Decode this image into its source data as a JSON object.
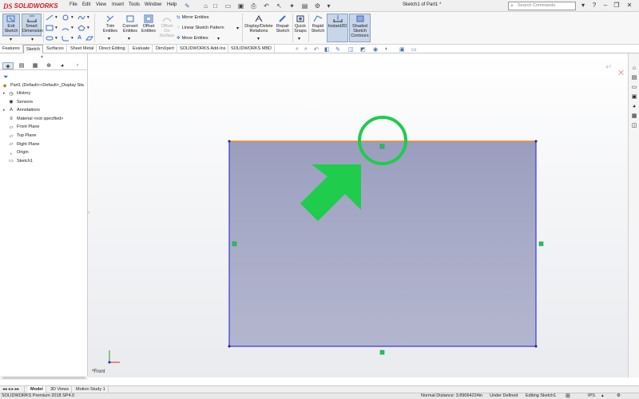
{
  "titlebar": {
    "app_logo": "SOLIDWORKS",
    "menus": [
      "File",
      "Edit",
      "View",
      "Insert",
      "Tools",
      "Window",
      "Help"
    ],
    "document_title": "Sketch1 of Part1 *",
    "search_placeholder": "Search Commands"
  },
  "ribbon": {
    "exit_sketch": [
      "Exit",
      "Sketch"
    ],
    "smart_dimension": [
      "Smart",
      "Dimension"
    ],
    "trim_entities": [
      "Trim",
      "Entities"
    ],
    "convert_entities": [
      "Convert",
      "Entities"
    ],
    "offset_entities": [
      "Offset",
      "Entities"
    ],
    "offset_on_surface": [
      "Offset",
      "On",
      "Surface"
    ],
    "mirror_entities": "Mirror Entities",
    "linear_sketch_pattern": "Linear Sketch Pattern",
    "move_entities": "Move Entities",
    "display_delete_relations": [
      "Display/Delete",
      "Relations"
    ],
    "repair_sketch": [
      "Repair",
      "Sketch"
    ],
    "quick_snaps": [
      "Quick",
      "Snaps"
    ],
    "rapid_sketch": [
      "Rapid",
      "Sketch"
    ],
    "instant2d": "Instant2D",
    "shaded_sketch_contours": [
      "Shaded",
      "Sketch",
      "Contours"
    ]
  },
  "command_tabs": [
    "Features",
    "Sketch",
    "Surfaces",
    "Sheet Metal",
    "Direct Editing",
    "Evaluate",
    "DimXpert",
    "SOLIDWORKS Add-Ins",
    "SOLIDWORKS MBD"
  ],
  "active_command_tab": "Sketch",
  "feature_tree": {
    "root": "Part1  (Default<<Default>_Display Sta",
    "items": [
      {
        "label": "History",
        "icon": "history-icon",
        "expandable": true
      },
      {
        "label": "Sensors",
        "icon": "sensors-icon",
        "expandable": false
      },
      {
        "label": "Annotations",
        "icon": "annotations-icon",
        "expandable": true
      },
      {
        "label": "Material <not specified>",
        "icon": "material-icon",
        "expandable": false
      },
      {
        "label": "Front Plane",
        "icon": "plane-icon",
        "expandable": false
      },
      {
        "label": "Top Plane",
        "icon": "plane-icon",
        "expandable": false
      },
      {
        "label": "Right Plane",
        "icon": "plane-icon",
        "expandable": false
      },
      {
        "label": "Origin",
        "icon": "origin-icon",
        "expandable": false
      },
      {
        "label": "Sketch1",
        "icon": "sketch-icon",
        "expandable": false
      }
    ]
  },
  "viewport": {
    "view_label": "*Front"
  },
  "bottom_tabs": [
    "Model",
    "3D Views",
    "Motion Study 1"
  ],
  "active_bottom_tab": "Model",
  "statusbar": {
    "product": "SOLIDWORKS Premium 2018 SP4.0",
    "normal_distance": "Normal Distance: 3.89064224in",
    "status": "Under Defined",
    "editing": "Editing Sketch1",
    "units": "IPS"
  },
  "colors": {
    "sketch_fill": "#a9acc6",
    "sketch_edge": "#3a3ad0",
    "selected_edge": "#f08a1f",
    "handle_green": "#22c55e",
    "annotation_green": "#1fcc4b",
    "logo_red": "#d32027"
  }
}
